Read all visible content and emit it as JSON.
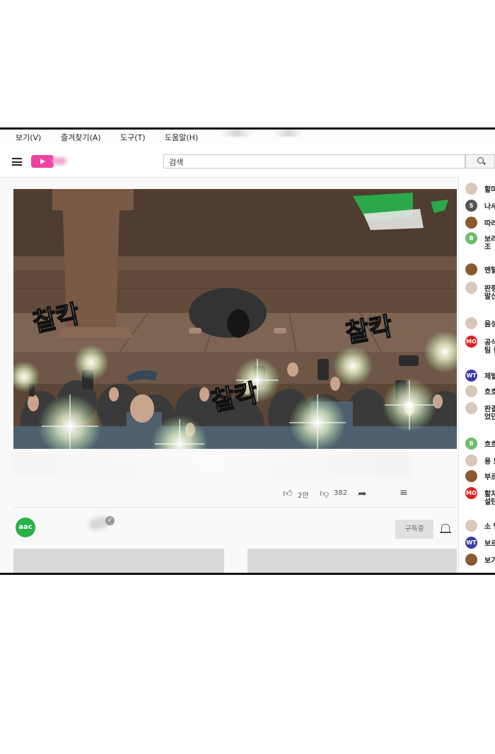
{
  "menu": {
    "items": [
      "보기(V)",
      "즐겨찾기(A)",
      "도구(T)",
      "도움말(H)"
    ]
  },
  "search": {
    "value": "검색"
  },
  "video": {
    "sfx": [
      "찰칵",
      "찰칵",
      "찰칵"
    ],
    "likes": "2만",
    "dislikes": "382"
  },
  "channel": {
    "logo_text": "aac",
    "subscribe_label": "구독중"
  },
  "chat": [
    {
      "avatar": "face",
      "color": "#d9c8b8",
      "line1": "할머",
      "line2": ""
    },
    {
      "avatar": "S",
      "color": "#555555",
      "line1": "나세",
      "line2": ""
    },
    {
      "avatar": "hair",
      "color": "#8a5a2e",
      "line1": "따라",
      "line2": ""
    },
    {
      "avatar": "B",
      "color": "#6cbc6c",
      "line1": "보리",
      "line2": "조"
    },
    {
      "avatar": "hair",
      "color": "#8a5a2e",
      "line1": "멘탈",
      "line2": ""
    },
    {
      "avatar": "face",
      "color": "#d9c8b8",
      "line1": "판평",
      "line2": "말신"
    },
    {
      "avatar": "face",
      "color": "#d9c8b8",
      "line1": "음성",
      "line2": ""
    },
    {
      "avatar": "MO",
      "color": "#e02020",
      "line1": "공식",
      "line2": "팀 될"
    },
    {
      "avatar": "WT",
      "color": "#3a3aa6",
      "line1": "제발",
      "line2": ""
    },
    {
      "avatar": "face",
      "color": "#d9c8b8",
      "line1": "흐흐",
      "line2": ""
    },
    {
      "avatar": "face",
      "color": "#d9c8b8",
      "line1": "판결",
      "line2": "었던"
    },
    {
      "avatar": "B",
      "color": "#6cbc6c",
      "line1": "흐흐",
      "line2": ""
    },
    {
      "avatar": "face",
      "color": "#d9c8b8",
      "line1": "용 보",
      "line2": ""
    },
    {
      "avatar": "hair",
      "color": "#8a5a2e",
      "line1": "부르",
      "line2": ""
    },
    {
      "avatar": "MO",
      "color": "#e02020",
      "line1": "할저",
      "line2": "설탄"
    },
    {
      "avatar": "face",
      "color": "#d9c8b8",
      "line1": "소 털",
      "line2": ""
    },
    {
      "avatar": "WT",
      "color": "#3a3aa6",
      "line1": "보르",
      "line2": ""
    },
    {
      "avatar": "hair",
      "color": "#8a5a2e",
      "line1": "보기",
      "line2": ""
    }
  ]
}
